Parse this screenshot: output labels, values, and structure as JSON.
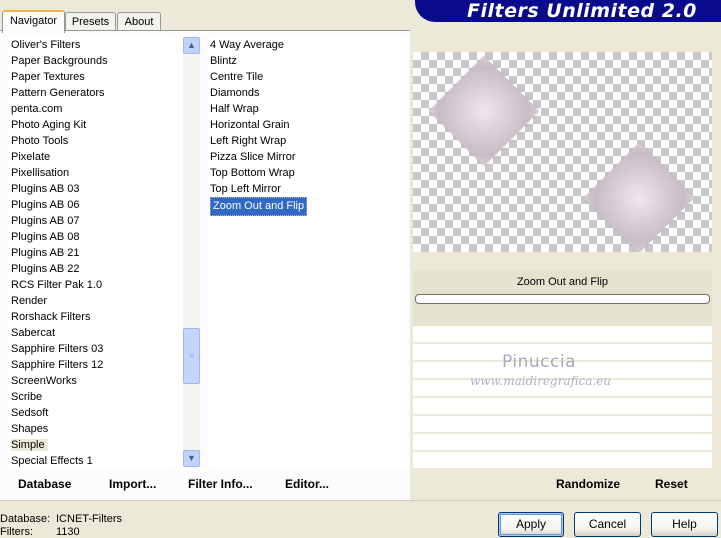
{
  "app": {
    "title": "Filters Unlimited 2.0"
  },
  "tabs": [
    {
      "label": "Navigator"
    },
    {
      "label": "Presets"
    },
    {
      "label": "About"
    }
  ],
  "categories": [
    "Oliver's Filters",
    "Paper Backgrounds",
    "Paper Textures",
    "Pattern Generators",
    "penta.com",
    "Photo Aging Kit",
    "Photo Tools",
    "Pixelate",
    "Pixellisation",
    "Plugins AB 03",
    "Plugins AB 06",
    "Plugins AB 07",
    "Plugins AB 08",
    "Plugins AB 21",
    "Plugins AB 22",
    "RCS Filter Pak 1.0",
    "Render",
    "Rorshack Filters",
    "Sabercat",
    "Sapphire Filters 03",
    "Sapphire Filters 12",
    "ScreenWorks",
    "Scribe",
    "Sedsoft",
    "Shapes",
    "Simple",
    "Special Effects 1"
  ],
  "selected_category": "Simple",
  "filters": [
    "4 Way Average",
    "Blintz",
    "Centre Tile",
    "Diamonds",
    "Half Wrap",
    "Horizontal Grain",
    "Left Right Wrap",
    "Pizza Slice Mirror",
    "Top Bottom Wrap",
    "Top Left Mirror",
    "Zoom Out and Flip"
  ],
  "selected_filter": "Zoom Out and Flip",
  "preview": {
    "filter_name": "Zoom Out and Flip"
  },
  "watermark": {
    "line1": "Pinuccia",
    "line2": "www.maidiregrafica.eu"
  },
  "links": {
    "database": "Database",
    "import": "Import...",
    "filter_info": "Filter Info...",
    "editor": "Editor...",
    "randomize": "Randomize",
    "reset": "Reset"
  },
  "info": {
    "database_label": "Database:",
    "database_value": "ICNET-Filters",
    "filters_label": "Filters:",
    "filters_value": "1130"
  },
  "buttons": {
    "apply": "Apply",
    "cancel": "Cancel",
    "help": "Help"
  },
  "colors": {
    "banner": "#0a0a8c",
    "selection": "#316ac5"
  }
}
